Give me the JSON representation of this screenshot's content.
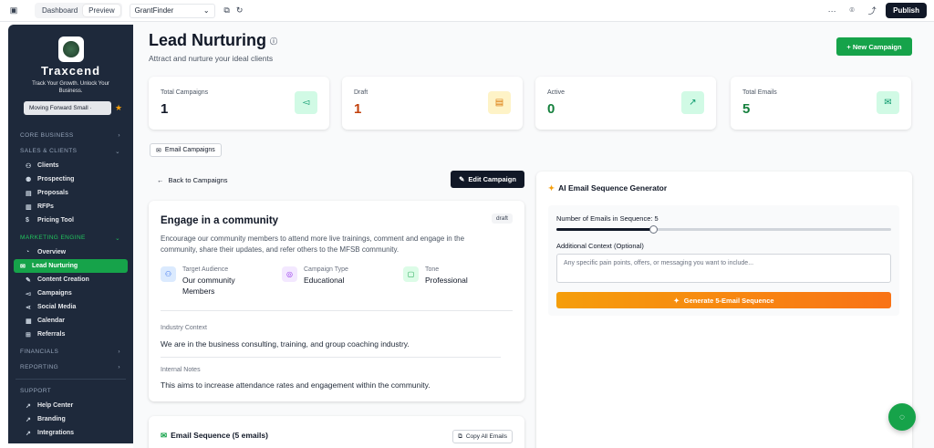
{
  "topbar": {
    "tabs": [
      "Dashboard",
      "Preview"
    ],
    "active_tab": "Preview",
    "project": "GrantFinder",
    "publish": "Publish"
  },
  "sidebar": {
    "brand": "Traxcend",
    "tagline": "Track Your Growth. Unlock Your Business.",
    "workspace": "Moving Forward Small ·",
    "sections": {
      "core": "CORE BUSINESS",
      "sales": "SALES & CLIENTS",
      "marketing": "MARKETING ENGINE",
      "financials": "FINANCIALS",
      "reporting": "REPORTING",
      "support": "SUPPORT"
    },
    "sales_items": [
      "Clients",
      "Prospecting",
      "Proposals",
      "RFPs",
      "Pricing Tool"
    ],
    "marketing_items": [
      "Overview",
      "Lead Nurturing",
      "Content Creation",
      "Campaigns",
      "Social Media",
      "Calendar",
      "Referrals"
    ],
    "support_items": [
      "Help Center",
      "Branding",
      "Integrations"
    ]
  },
  "header": {
    "title": "Lead Nurturing",
    "subtitle": "Attract and nurture your ideal clients",
    "new_campaign": "+ New Campaign"
  },
  "stats": [
    {
      "label": "Total Campaigns",
      "value": "1",
      "color": "#111827",
      "icon": "megaphone-icon"
    },
    {
      "label": "Draft",
      "value": "1",
      "color": "#c2410c",
      "icon": "document-icon"
    },
    {
      "label": "Active",
      "value": "0",
      "color": "#15803d",
      "icon": "trending-up-icon"
    },
    {
      "label": "Total Emails",
      "value": "5",
      "color": "#15803d",
      "icon": "mail-icon"
    }
  ],
  "tab_chip": "Email Campaigns",
  "back_label": "Back to Campaigns",
  "edit_label": "Edit Campaign",
  "campaign": {
    "title": "Engage in a community",
    "status": "draft",
    "description": "Encourage our community members to attend more live trainings, comment and engage in the community, share their updates, and refer others to the MFSB community.",
    "audience_label": "Target Audience",
    "audience": "Our community Members",
    "type_label": "Campaign Type",
    "type": "Educational",
    "tone_label": "Tone",
    "tone": "Professional",
    "industry_label": "Industry Context",
    "industry": "We are in the business consulting, training, and group coaching industry.",
    "notes_label": "Internal Notes",
    "notes": "This aims to increase attendance rates and engagement within the community."
  },
  "sequence": {
    "title": "Email Sequence (5 emails)",
    "copy_all": "Copy All Emails"
  },
  "ai": {
    "title": "AI Email Sequence Generator",
    "count_label": "Number of Emails in Sequence: 5",
    "count_fraction": 0.29,
    "context_label": "Additional Context (Optional)",
    "context_placeholder": "Any specific pain points, offers, or messaging you want to include...",
    "generate": "Generate 5-Email Sequence"
  }
}
